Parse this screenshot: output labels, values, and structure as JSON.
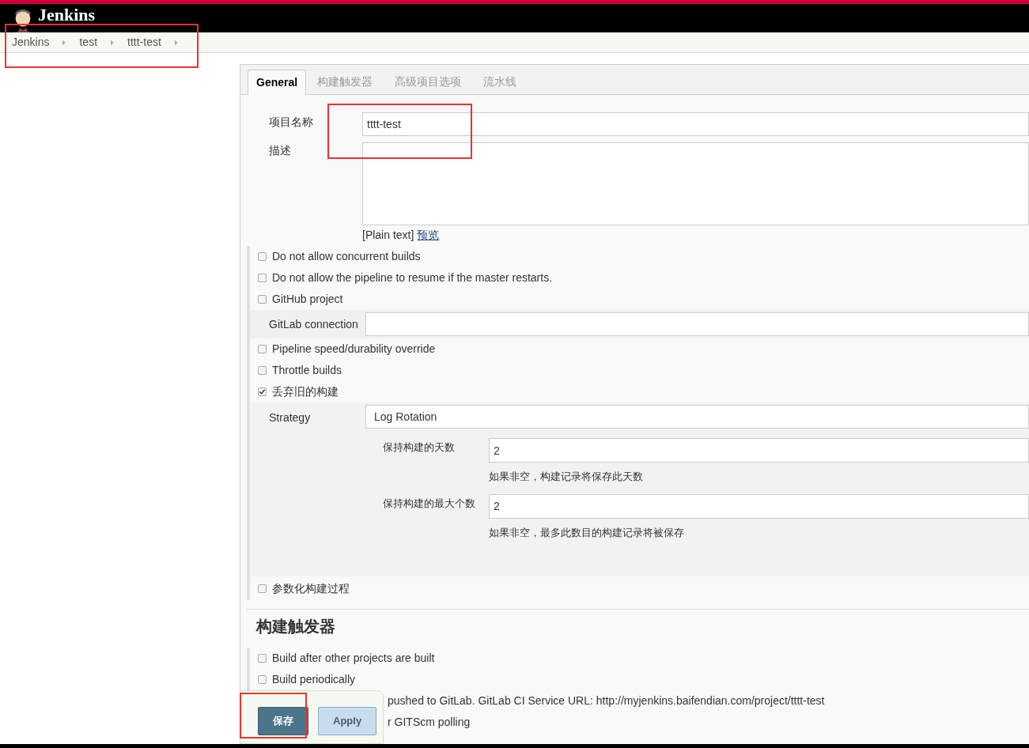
{
  "header": {
    "title": "Jenkins"
  },
  "breadcrumbs": [
    "Jenkins",
    "test",
    "tttt-test"
  ],
  "tabs": [
    {
      "label": "General",
      "selected": true
    },
    {
      "label": "构建触发器",
      "selected": false
    },
    {
      "label": "高级项目选项",
      "selected": false
    },
    {
      "label": "流水线",
      "selected": false
    }
  ],
  "general": {
    "project_name": {
      "label": "项目名称",
      "value": "tttt-test"
    },
    "description": {
      "label": "描述",
      "format": "[Plain text]",
      "preview_link": "预览"
    },
    "options_before": [
      {
        "label": "Do not allow concurrent builds",
        "checked": false
      },
      {
        "label": "Do not allow the pipeline to resume if the master restarts.",
        "checked": false
      },
      {
        "label": "GitHub project",
        "checked": false
      }
    ],
    "gitlab_connection": {
      "label": "GitLab connection"
    },
    "options_after": [
      {
        "label": "Pipeline speed/durability override",
        "checked": false
      },
      {
        "label": "Throttle builds",
        "checked": false
      },
      {
        "label": "丢弃旧的构建",
        "checked": true
      }
    ],
    "discard_builds": {
      "strategy": {
        "label": "Strategy",
        "value": "Log Rotation"
      },
      "fields": [
        {
          "label": "保持构建的天数",
          "value": "2",
          "help": "如果非空，构建记录将保存此天数"
        },
        {
          "label": "保持构建的最大个数",
          "value": "2",
          "help": "如果非空，最多此数目的构建记录将被保存"
        }
      ]
    },
    "option_last": {
      "label": "参数化构建过程",
      "checked": false
    }
  },
  "triggers": {
    "heading": "构建触发器",
    "options": [
      {
        "kind": "full",
        "label": "Build after other projects are built",
        "checked": false
      },
      {
        "kind": "full",
        "label": "Build periodically",
        "checked": false
      },
      {
        "kind": "partial",
        "label": "pushed to GitLab. GitLab CI Service URL: http://myjenkins.baifendian.com/project/tttt-test"
      },
      {
        "kind": "partial",
        "label": "r GITScm polling"
      }
    ]
  },
  "footer": {
    "buttons": [
      {
        "label": "保存",
        "kind": "primary"
      },
      {
        "label": "Apply",
        "kind": "secondary"
      }
    ]
  }
}
